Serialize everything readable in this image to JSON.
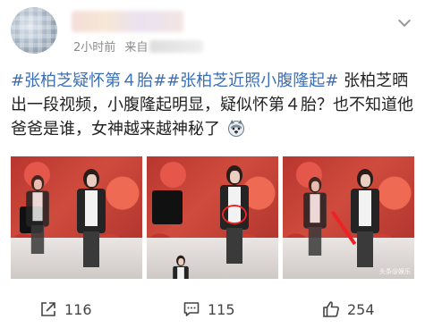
{
  "post": {
    "meta_time": "2小时前",
    "meta_source_prefix": "来自",
    "tag1": "#张柏芝疑怀第４胎#",
    "tag2": "#张柏芝近照小腹隆起#",
    "body": " 张柏芝晒出一段视频，小腹隆起明显，疑似怀第４胎？也不知道他爸爸是谁，女神越来越神秘了",
    "emoji": "husky-emoji"
  },
  "images": [
    {
      "alt": "photo-1"
    },
    {
      "alt": "photo-2"
    },
    {
      "alt": "photo-3",
      "watermark": "头条@娱乐"
    }
  ],
  "actions": {
    "share_count": "116",
    "comment_count": "115",
    "like_count": "254"
  }
}
